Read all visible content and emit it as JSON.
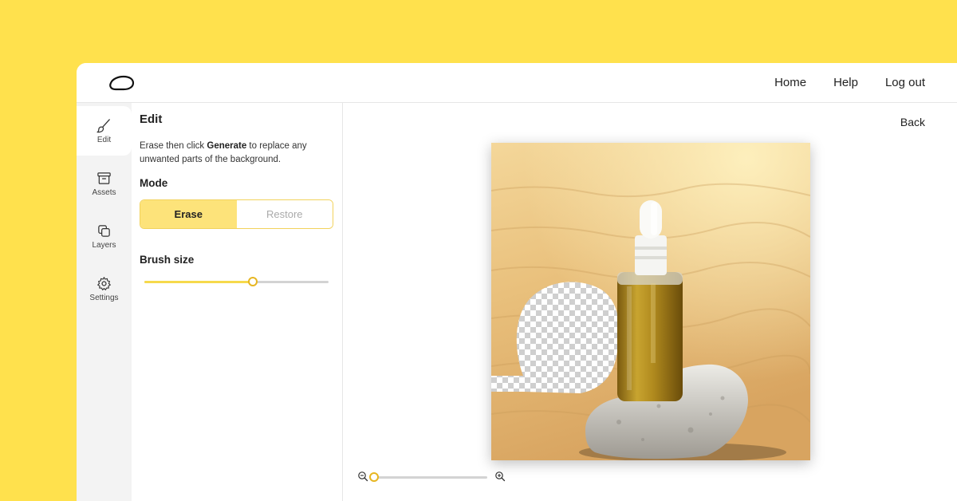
{
  "topbar": {
    "nav": [
      "Home",
      "Help",
      "Log out"
    ]
  },
  "rail": {
    "items": [
      {
        "label": "Edit",
        "icon": "brush-icon",
        "active": true
      },
      {
        "label": "Assets",
        "icon": "archive-icon",
        "active": false
      },
      {
        "label": "Layers",
        "icon": "layers-icon",
        "active": false
      },
      {
        "label": "Settings",
        "icon": "gear-icon",
        "active": false
      }
    ]
  },
  "panel": {
    "title": "Edit",
    "desc_prefix": "Erase then click ",
    "desc_bold": "Generate",
    "desc_suffix": " to replace any unwanted parts of the background.",
    "mode_label": "Mode",
    "mode_options": [
      "Erase",
      "Restore"
    ],
    "mode_selected": "Erase",
    "brush_label": "Brush size",
    "brush_size": 0.59
  },
  "canvas": {
    "back_label": "Back",
    "zoom": 0.0
  },
  "colors": {
    "background": "#FFE14D",
    "accent": "#FDE37A",
    "accent_border": "#F2D25C"
  }
}
